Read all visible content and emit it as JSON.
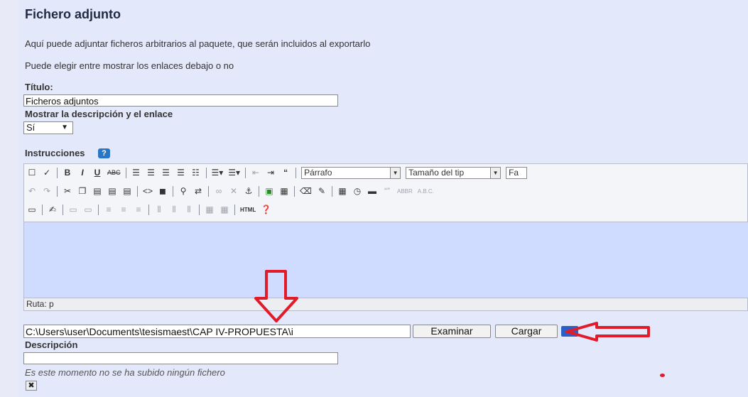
{
  "section": {
    "title": "Fichero adjunto",
    "description1": "Aquí puede adjuntar ficheros arbitrarios al paquete, que serán incluidos al exportarlo",
    "description2": "Puede elegir entre mostrar los enlaces debajo o no"
  },
  "titulo": {
    "label": "Título:",
    "value": "Ficheros adjuntos"
  },
  "mostrar": {
    "label": "Mostrar la descripción y el enlace",
    "value": "Sí"
  },
  "instrucciones": {
    "label": "Instrucciones",
    "help_icon": "?",
    "toolbar": {
      "format_select": "Párrafo",
      "size_select": "Tamaño del tip",
      "font_select_partial": "Fa",
      "html_label": "HTML"
    },
    "statusbar": "Ruta: p"
  },
  "upload": {
    "path_value": "C:\\Users\\user\\Documents\\tesismaest\\CAP IV-PROPUESTA\\i",
    "browse_label": "Examinar",
    "upload_label": "Cargar"
  },
  "descripcion": {
    "label": "Descripción",
    "value": ""
  },
  "status_note": "Es este momento no se ha subido ningún fichero",
  "annotation_color": "#e21b2a"
}
